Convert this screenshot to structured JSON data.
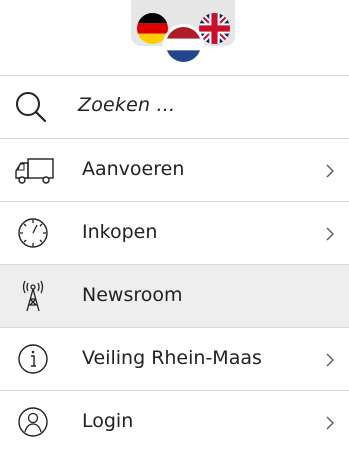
{
  "languages": [
    {
      "code": "de",
      "name": "Deutsch"
    },
    {
      "code": "nl",
      "name": "Nederlands"
    },
    {
      "code": "en",
      "name": "English"
    }
  ],
  "search": {
    "placeholder": "Zoeken ..."
  },
  "menu": [
    {
      "label": "Aanvoeren",
      "icon": "truck-icon",
      "has_submenu": true
    },
    {
      "label": "Inkopen",
      "icon": "clock-icon",
      "has_submenu": true
    },
    {
      "label": "Newsroom",
      "icon": "antenna-icon",
      "has_submenu": false,
      "active": true
    },
    {
      "label": "Veiling Rhein-Maas",
      "icon": "info-icon",
      "has_submenu": true
    },
    {
      "label": "Login",
      "icon": "user-icon",
      "has_submenu": true
    }
  ],
  "colors": {
    "active_bg": "#eeeeee",
    "divider": "#d9d9d9",
    "nl_red": "#ae1c28",
    "nl_blue": "#21468b"
  }
}
